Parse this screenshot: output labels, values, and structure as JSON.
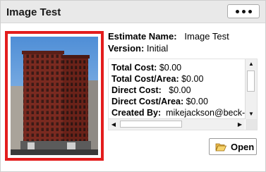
{
  "card": {
    "title": "Image Test",
    "menu_icon": "more-horizontal-icon"
  },
  "meta": {
    "estimate_name_label": "Estimate Name:",
    "estimate_name_value": "Image Test",
    "version_label": "Version:",
    "version_value": "Initial"
  },
  "details": {
    "total_cost_label": "Total Cost:",
    "total_cost_value": "$0.00",
    "total_cost_area_label": "Total Cost/Area:",
    "total_cost_area_value": "$0.00",
    "direct_cost_label": "Direct Cost:",
    "direct_cost_value": "$0.00",
    "direct_cost_area_label": "Direct Cost/Area:",
    "direct_cost_area_value": "$0.00",
    "created_by_label": "Created By:",
    "created_by_value": "mikejackson@beck-te"
  },
  "actions": {
    "open_label": "Open",
    "open_icon": "folder-open-icon"
  },
  "colors": {
    "header_bg": "#e9e9e9",
    "thumbnail_border": "#e31d1d"
  }
}
